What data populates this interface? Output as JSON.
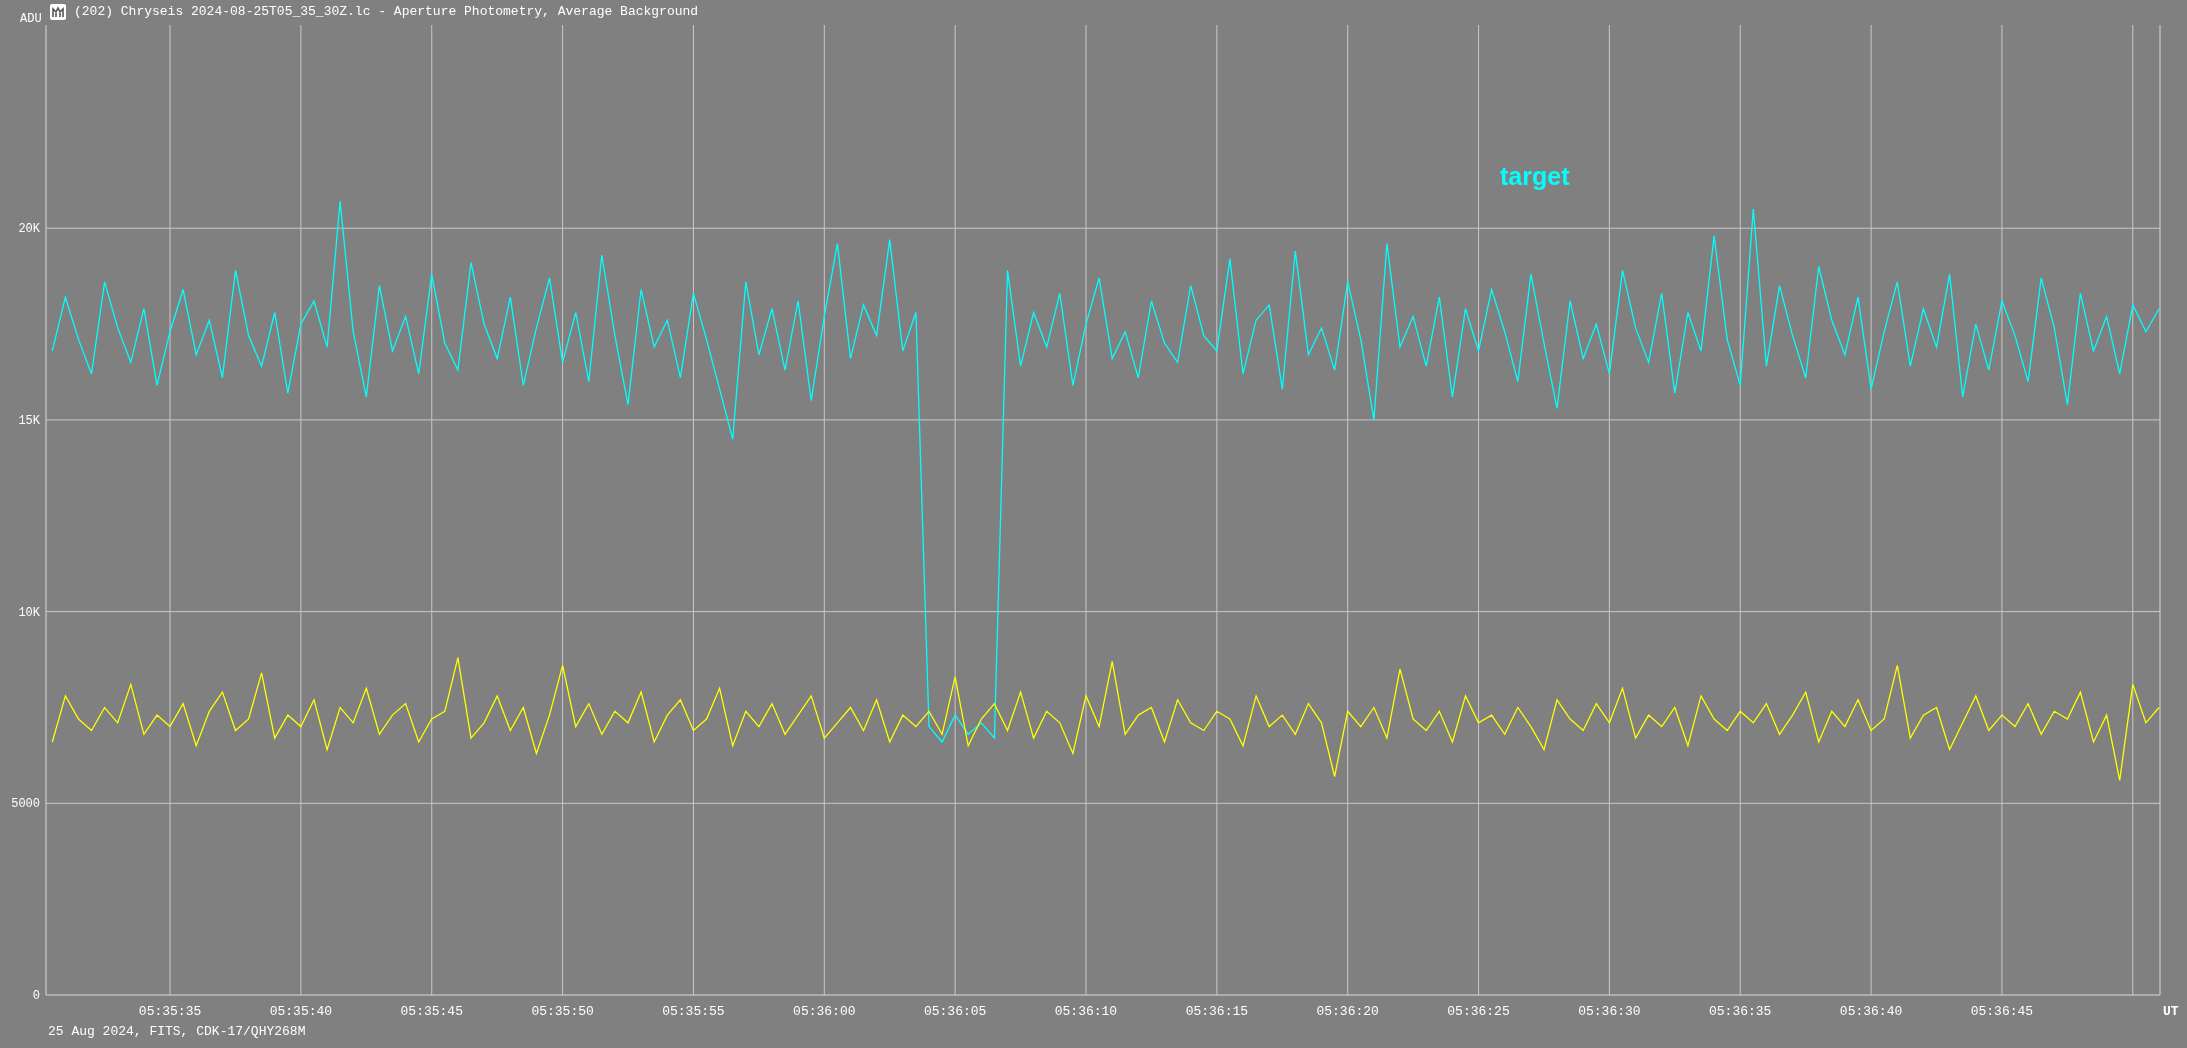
{
  "window": {
    "title": "(202) Chryseis 2024-08-25T05_35_30Z.lc - Aperture Photometry, Average Background"
  },
  "chart": {
    "chart_data": {
      "type": "line",
      "ylabel": "ADU",
      "xlabel": "UT",
      "xlim": [
        20130.26,
        20211.04
      ],
      "ylim": [
        0,
        25300
      ],
      "xticks": [
        {
          "value": 20135,
          "label": "05:35:35"
        },
        {
          "value": 20140,
          "label": "05:35:40"
        },
        {
          "value": 20145,
          "label": "05:35:45"
        },
        {
          "value": 20150,
          "label": "05:35:50"
        },
        {
          "value": 20155,
          "label": "05:35:55"
        },
        {
          "value": 20160,
          "label": "05:36:00"
        },
        {
          "value": 20165,
          "label": "05:36:05"
        },
        {
          "value": 20170,
          "label": "05:36:10"
        },
        {
          "value": 20175,
          "label": "05:36:15"
        },
        {
          "value": 20180,
          "label": "05:36:20"
        },
        {
          "value": 20185,
          "label": "05:36:25"
        },
        {
          "value": 20190,
          "label": "05:36:30"
        },
        {
          "value": 20195,
          "label": "05:36:35"
        },
        {
          "value": 20200,
          "label": "05:36:40"
        },
        {
          "value": 20205,
          "label": "05:36:45"
        }
      ],
      "grid": true,
      "yticks": [
        0,
        5000,
        {
          "value": 10000,
          "label": "10K"
        },
        {
          "value": 15000,
          "label": "15K"
        },
        {
          "value": 20000,
          "label": "20K"
        }
      ],
      "x": [
        20130.5,
        20131,
        20131.5,
        20132,
        20132.5,
        20133,
        20133.5,
        20134,
        20134.5,
        20135,
        20135.5,
        20136,
        20136.5,
        20137,
        20137.5,
        20138,
        20138.5,
        20139,
        20139.5,
        20140,
        20140.5,
        20141,
        20141.5,
        20142,
        20142.5,
        20143,
        20143.5,
        20144,
        20144.5,
        20145,
        20145.5,
        20146,
        20146.5,
        20147,
        20147.5,
        20148,
        20148.5,
        20149,
        20149.5,
        20150,
        20150.5,
        20151,
        20151.5,
        20152,
        20152.5,
        20153,
        20153.5,
        20154,
        20154.5,
        20155,
        20155.5,
        20156,
        20156.5,
        20157,
        20157.5,
        20158,
        20158.5,
        20159,
        20159.5,
        20160,
        20160.5,
        20161,
        20161.5,
        20162,
        20162.5,
        20163,
        20163.5,
        20164,
        20164.5,
        20165,
        20165.5,
        20166,
        20166.5,
        20167,
        20167.5,
        20168,
        20168.5,
        20169,
        20169.5,
        20170,
        20170.5,
        20171,
        20171.5,
        20172,
        20172.5,
        20173,
        20173.5,
        20174,
        20174.5,
        20175,
        20175.5,
        20176,
        20176.5,
        20177,
        20177.5,
        20178,
        20178.5,
        20179,
        20179.5,
        20180,
        20180.5,
        20181,
        20181.5,
        20182,
        20182.5,
        20183,
        20183.5,
        20184,
        20184.5,
        20185,
        20185.5,
        20186,
        20186.5,
        20187,
        20187.5,
        20188,
        20188.5,
        20189,
        20189.5,
        20190,
        20190.5,
        20191,
        20191.5,
        20192,
        20192.5,
        20193,
        20193.5,
        20194,
        20194.5,
        20195,
        20195.5,
        20196,
        20196.5,
        20197,
        20197.5,
        20198,
        20198.5,
        20199,
        20199.5,
        20200,
        20200.5,
        20201,
        20201.5,
        20202,
        20202.5,
        20203,
        20203.5,
        20204,
        20204.5,
        20205,
        20205.5,
        20206,
        20206.5,
        20207,
        20207.5,
        20208,
        20208.5,
        20209,
        20209.5,
        20210,
        20210.5,
        20211
      ],
      "series": [
        {
          "name": "target",
          "color": "#00ffff",
          "values": [
            16800,
            18200,
            17100,
            16200,
            18600,
            17400,
            16500,
            17900,
            15900,
            17300,
            18400,
            16700,
            17600,
            16100,
            18900,
            17200,
            16400,
            17800,
            15700,
            17500,
            18100,
            16900,
            20700,
            17300,
            15600,
            18500,
            16800,
            17700,
            16200,
            18800,
            17000,
            16300,
            19100,
            17500,
            16600,
            18200,
            15900,
            17400,
            18700,
            16500,
            17800,
            16000,
            19300,
            17200,
            15400,
            18400,
            16900,
            17600,
            16100,
            18300,
            17100,
            15800,
            14500,
            18600,
            16700,
            17900,
            16300,
            18100,
            15500,
            17700,
            19600,
            16600,
            18000,
            17200,
            19700,
            16800,
            17800,
            7000,
            6600,
            7300,
            6800,
            7100,
            6700,
            18900,
            16400,
            17800,
            16900,
            18300,
            15900,
            17500,
            18700,
            16600,
            17300,
            16100,
            18100,
            17000,
            16500,
            18500,
            17200,
            16800,
            19200,
            16200,
            17600,
            18000,
            15800,
            19400,
            16700,
            17400,
            16300,
            18600,
            17100,
            15000,
            19600,
            16900,
            17700,
            16400,
            18200,
            15600,
            17900,
            16800,
            18400,
            17300,
            16000,
            18800,
            17000,
            15300,
            18100,
            16600,
            17500,
            16200,
            18900,
            17400,
            16500,
            18300,
            15700,
            17800,
            16800,
            19800,
            17100,
            15900,
            20500,
            16400,
            18500,
            17200,
            16100,
            19000,
            17600,
            16700,
            18200,
            15800,
            17300,
            18600,
            16400,
            17900,
            16900,
            18800,
            15600,
            17500,
            16300,
            18100,
            17200,
            16000,
            18700,
            17400,
            15400,
            18300,
            16800,
            17700,
            16200,
            18000,
            17300,
            17900
          ]
        },
        {
          "color": "#ffff00",
          "values": [
            6600,
            7800,
            7200,
            6900,
            7500,
            7100,
            8100,
            6800,
            7300,
            7000,
            7600,
            6500,
            7400,
            7900,
            6900,
            7200,
            8400,
            6700,
            7300,
            7000,
            7700,
            6400,
            7500,
            7100,
            8000,
            6800,
            7300,
            7600,
            6600,
            7200,
            7400,
            8800,
            6700,
            7100,
            7800,
            6900,
            7500,
            6300,
            7300,
            8600,
            7000,
            7600,
            6800,
            7400,
            7100,
            7900,
            6600,
            7300,
            7700,
            6900,
            7200,
            8000,
            6500,
            7400,
            7000,
            7600,
            6800,
            7300,
            7800,
            6700,
            7100,
            7500,
            6900,
            7700,
            6600,
            7300,
            7000,
            7400,
            6800,
            8300,
            6500,
            7200,
            7600,
            6900,
            7900,
            6700,
            7400,
            7100,
            6300,
            7800,
            7000,
            8700,
            6800,
            7300,
            7500,
            6600,
            7700,
            7100,
            6900,
            7400,
            7200,
            6500,
            7800,
            7000,
            7300,
            6800,
            7600,
            7100,
            5700,
            7400,
            7000,
            7500,
            6700,
            8500,
            7200,
            6900,
            7400,
            6600,
            7800,
            7100,
            7300,
            6800,
            7500,
            7000,
            6400,
            7700,
            7200,
            6900,
            7600,
            7100,
            8000,
            6700,
            7300,
            7000,
            7500,
            6500,
            7800,
            7200,
            6900,
            7400,
            7100,
            7600,
            6800,
            7300,
            7900,
            6600,
            7400,
            7000,
            7700,
            6900,
            7200,
            8600,
            6700,
            7300,
            7500,
            6400,
            7100,
            7800,
            6900,
            7300,
            7000,
            7600,
            6800,
            7400,
            7200,
            7900,
            6600,
            7300,
            5600,
            8100,
            7100,
            7500
          ]
        }
      ]
    }
  },
  "footer": "25 Aug 2024, FITS, CDK-17/QHY268M"
}
